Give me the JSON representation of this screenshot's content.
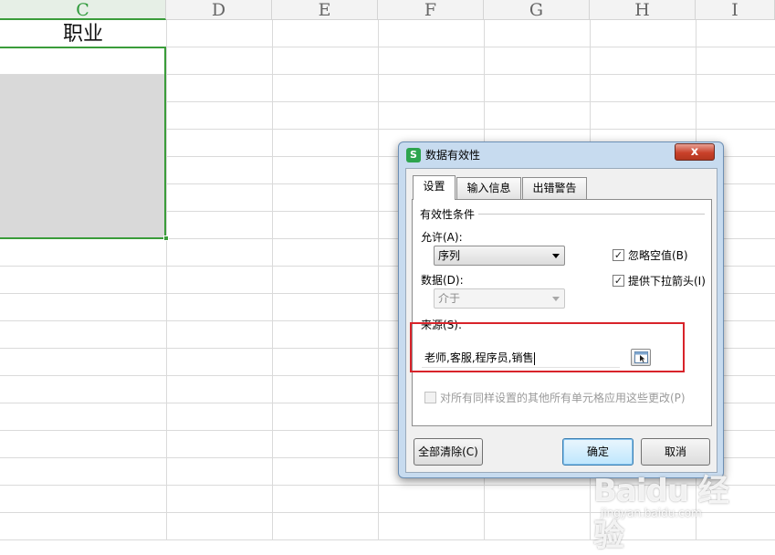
{
  "spreadsheet": {
    "columns": [
      {
        "label": "C",
        "active": true
      },
      {
        "label": "D"
      },
      {
        "label": "E"
      },
      {
        "label": "F"
      },
      {
        "label": "G"
      },
      {
        "label": "H"
      },
      {
        "label": "I"
      }
    ],
    "header_cell_text": "职业",
    "accent_color": "#3a9c3a"
  },
  "dialog": {
    "title": "数据有效性",
    "app_icon_letter": "S",
    "close_symbol": "x",
    "tabs": [
      {
        "label": "设置",
        "active": true
      },
      {
        "label": "输入信息"
      },
      {
        "label": "出错警告"
      }
    ],
    "settings": {
      "group_title": "有效性条件",
      "allow_label": "允许(A):",
      "allow_value": "序列",
      "data_label": "数据(D):",
      "data_value": "介于",
      "ignore_blank": {
        "label": "忽略空值(B)",
        "checked": true
      },
      "dropdown_arrow": {
        "label": "提供下拉箭头(I)",
        "checked": true
      },
      "source_label": "来源(S):",
      "source_value": "老师,客服,程序员,销售",
      "apply_all": {
        "label": "对所有同样设置的其他所有单元格应用这些更改(P)",
        "checked": false,
        "disabled": true
      }
    },
    "buttons": {
      "clear_all": "全部清除(C)",
      "ok": "确定",
      "cancel": "取消"
    }
  },
  "annotation": {
    "color": "#d8232a"
  },
  "watermark": {
    "main": "Baidu 经验",
    "sub": "jingyan.baidu.com"
  }
}
